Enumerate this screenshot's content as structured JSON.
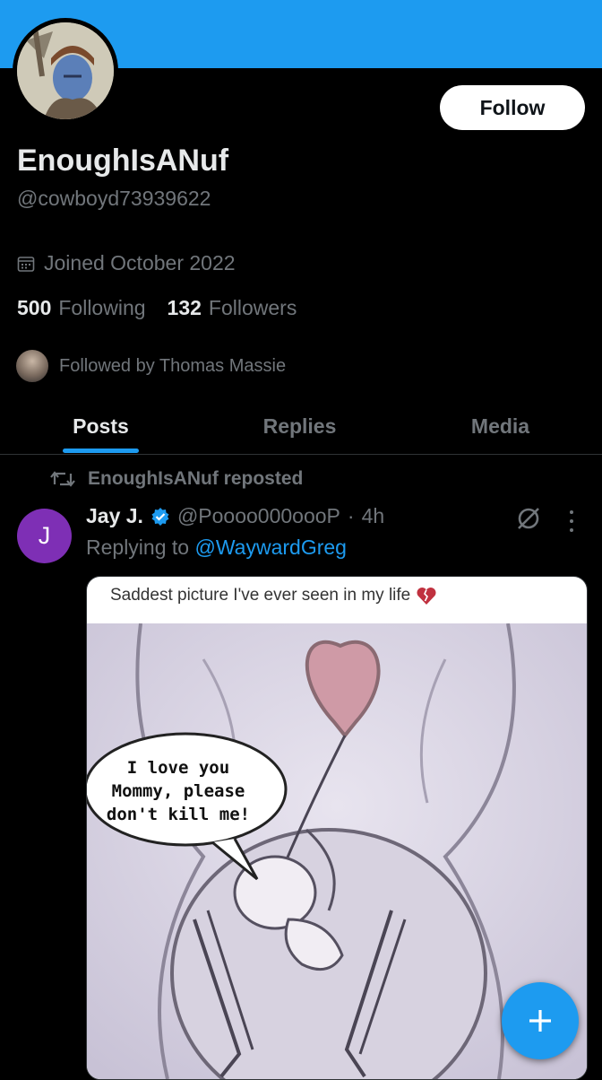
{
  "profile": {
    "display_name": "EnoughIsANuf",
    "handle": "@cowboyd73939622",
    "joined": "Joined October 2022",
    "following_count": "500",
    "following_label": "Following",
    "followers_count": "132",
    "followers_label": "Followers",
    "followed_by": "Followed by Thomas Massie",
    "follow_label": "Follow",
    "banner_color": "#1d9bf0"
  },
  "tabs": [
    {
      "label": "Posts",
      "active": true
    },
    {
      "label": "Replies",
      "active": false
    },
    {
      "label": "Media",
      "active": false
    }
  ],
  "post": {
    "repost_label": "EnoughIsANuf reposted",
    "avatar_letter": "J",
    "avatar_color": "#7e2fb5",
    "author": "Jay J.",
    "handle": "@Poooo000oooP",
    "separator": "·",
    "time": "4h",
    "replying_prefix": "Replying to",
    "replying_to": "@WaywardGreg",
    "media": {
      "caption": "Saddest picture I've ever seen in my life",
      "caption_emoji": "broken-heart-icon",
      "bubble_line1": "I love you",
      "bubble_line2": "Mommy, please",
      "bubble_line3": "don't kill me!"
    }
  },
  "icons": {
    "calendar": "calendar-icon",
    "repost": "repost-icon",
    "verified": "verified-badge-icon",
    "grok": "grok-icon",
    "more": "more-icon",
    "compose": "compose-plus-icon"
  },
  "accent": "#1d9bf0"
}
